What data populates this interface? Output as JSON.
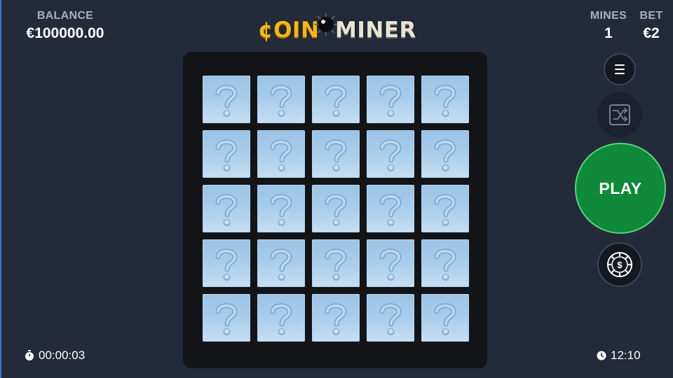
{
  "header": {
    "balance_label": "BALANCE",
    "balance_value": "€100000.00",
    "mines_label": "MINES",
    "mines_value": "1",
    "bet_label": "BET",
    "bet_value": "€2",
    "logo_part1": "¢OIN",
    "logo_part2": "MINER"
  },
  "board": {
    "rows": 5,
    "cols": 5,
    "tile_state": "hidden",
    "tile_icon": "question-mark-icon"
  },
  "controls": {
    "menu_icon": "hamburger-menu-icon",
    "shuffle_icon": "shuffle-icon",
    "play_label": "PLAY",
    "cashout_icon": "dollar-chip-icon"
  },
  "footer": {
    "timer_icon": "stopwatch-icon",
    "timer_value": "00:00:03",
    "clock_icon": "clock-icon",
    "clock_value": "12:10"
  },
  "colors": {
    "background": "#232b3a",
    "board": "#121418",
    "tile": "#a9cdeb",
    "play": "#0e8a3a",
    "logo_gold": "#f2b51c"
  }
}
